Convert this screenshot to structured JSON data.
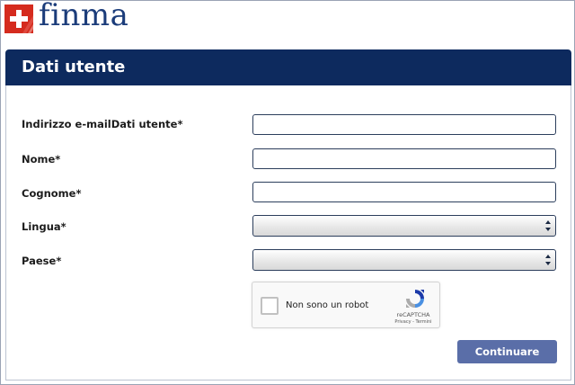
{
  "brand": {
    "name": "finma"
  },
  "header": {
    "title": "Dati utente"
  },
  "form": {
    "email_label": "Indirizzo e-mailDati utente*",
    "email_value": "",
    "first_name_label": "Nome*",
    "first_name_value": "",
    "last_name_label": "Cognome*",
    "last_name_value": "",
    "language_label": "Lingua*",
    "language_value": "",
    "country_label": "Paese*",
    "country_value": ""
  },
  "captcha": {
    "label": "Non sono un robot",
    "brand": "reCAPTCHA",
    "links": "Privacy - Termini",
    "icon": "recaptcha-logo"
  },
  "actions": {
    "continue_label": "Continuare"
  },
  "colors": {
    "header_bg": "#0d2a5e",
    "brand_text": "#1b3c7a",
    "flag_red": "#d52b1e",
    "button_bg": "#5a6ea8"
  }
}
